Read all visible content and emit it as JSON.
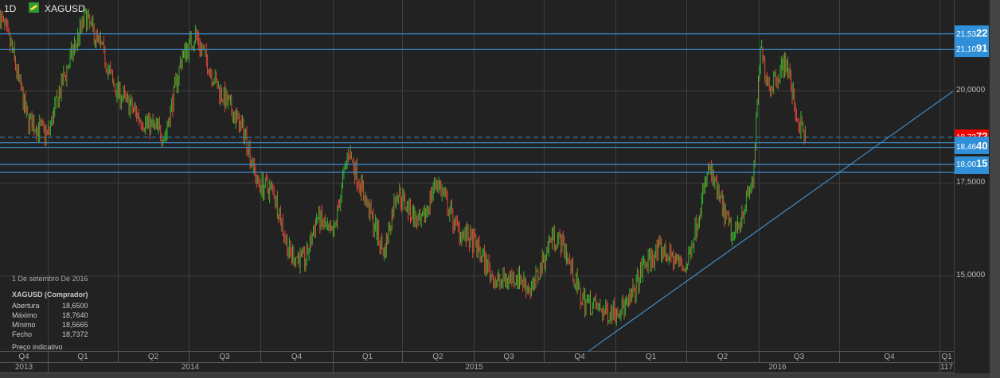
{
  "header": {
    "timeframe": "1D",
    "symbol": "XAGUSD",
    "symbol_icon": "gold-bar-icon"
  },
  "info": {
    "date": "1 De setembro De 2016",
    "title": "XAGUSD (Comprador)",
    "rows": [
      {
        "label": "Abertura",
        "value": "18,6500"
      },
      {
        "label": "Máximo",
        "value": "18,7640"
      },
      {
        "label": "Mínimo",
        "value": "18,5665"
      },
      {
        "label": "Fecho",
        "value": "18,7372"
      }
    ],
    "note": "Preço indicativo"
  },
  "price_axis": {
    "ticks": [
      "20,0000",
      "17,5000",
      "15,0000"
    ],
    "current": {
      "prefix": "18,73",
      "suffix": "72",
      "value": 18.7372,
      "color": "#ee0000"
    },
    "levels": [
      {
        "prefix": "21,53",
        "suffix": "22",
        "value": 21.5322
      },
      {
        "prefix": "21,10",
        "suffix": "91",
        "value": 21.1091
      },
      {
        "prefix": "18,46",
        "suffix": "40",
        "value": 18.464
      },
      {
        "prefix": "18,00",
        "suffix": "15",
        "value": 18.0015
      }
    ],
    "extra_lines": [
      18.59,
      17.79
    ]
  },
  "time_axis": {
    "quarters": [
      "Q4",
      "Q1",
      "Q2",
      "Q3",
      "Q4",
      "Q1",
      "Q2",
      "Q3",
      "Q4",
      "Q1",
      "Q2",
      "Q3",
      "Q4",
      "Q1"
    ],
    "years": [
      "2013",
      "2014",
      "2015",
      "2016",
      "117"
    ]
  },
  "colors": {
    "up": "#2fb52f",
    "down": "#e0473a",
    "mixed": "#8c8a2c",
    "line": "#3d8fd0",
    "bg": "#222222"
  },
  "chart_data": {
    "type": "candlestick",
    "symbol": "XAGUSD",
    "ylim": [
      12.5,
      22.6
    ],
    "trendline": [
      [
        "2015-11-24",
        12.92
      ],
      [
        "2017-02-10",
        19.98
      ]
    ],
    "path": [
      [
        "2013-11-01",
        22.0
      ],
      [
        "2013-11-16",
        21.1
      ],
      [
        "2013-12-06",
        19.2
      ],
      [
        "2014-01-01",
        18.8
      ],
      [
        "2014-01-21",
        20.3
      ],
      [
        "2014-02-18",
        22.0
      ],
      [
        "2014-03-12",
        21.1
      ],
      [
        "2014-03-27",
        20.1
      ],
      [
        "2014-05-02",
        19.2
      ],
      [
        "2014-06-01",
        18.8
      ],
      [
        "2014-06-22",
        20.9
      ],
      [
        "2014-07-10",
        21.5
      ],
      [
        "2014-08-07",
        20.1
      ],
      [
        "2014-09-12",
        18.8
      ],
      [
        "2014-09-27",
        17.5
      ],
      [
        "2014-10-18",
        17.3
      ],
      [
        "2014-11-07",
        15.6
      ],
      [
        "2014-11-28",
        15.4
      ],
      [
        "2014-12-13",
        16.6
      ],
      [
        "2015-01-02",
        16.0
      ],
      [
        "2015-01-22",
        18.4
      ],
      [
        "2015-02-12",
        17.1
      ],
      [
        "2015-03-09",
        15.6
      ],
      [
        "2015-03-25",
        17.3
      ],
      [
        "2015-04-25",
        16.3
      ],
      [
        "2015-05-15",
        17.6
      ],
      [
        "2015-06-10",
        16.3
      ],
      [
        "2015-07-05",
        15.8
      ],
      [
        "2015-07-31",
        14.8
      ],
      [
        "2015-08-26",
        15.0
      ],
      [
        "2015-09-15",
        14.6
      ],
      [
        "2015-10-11",
        16.1
      ],
      [
        "2015-10-26",
        15.8
      ],
      [
        "2015-11-16",
        14.4
      ],
      [
        "2015-12-17",
        14.0
      ],
      [
        "2016-01-17",
        14.2
      ],
      [
        "2016-02-06",
        15.3
      ],
      [
        "2016-02-27",
        15.7
      ],
      [
        "2016-03-31",
        15.2
      ],
      [
        "2016-04-29",
        17.9
      ],
      [
        "2016-05-30",
        16.0
      ],
      [
        "2016-06-25",
        17.6
      ],
      [
        "2016-07-04",
        21.1
      ],
      [
        "2016-07-16",
        20.1
      ],
      [
        "2016-08-06",
        20.8
      ],
      [
        "2016-08-21",
        19.2
      ],
      [
        "2016-09-01",
        18.7
      ]
    ]
  }
}
